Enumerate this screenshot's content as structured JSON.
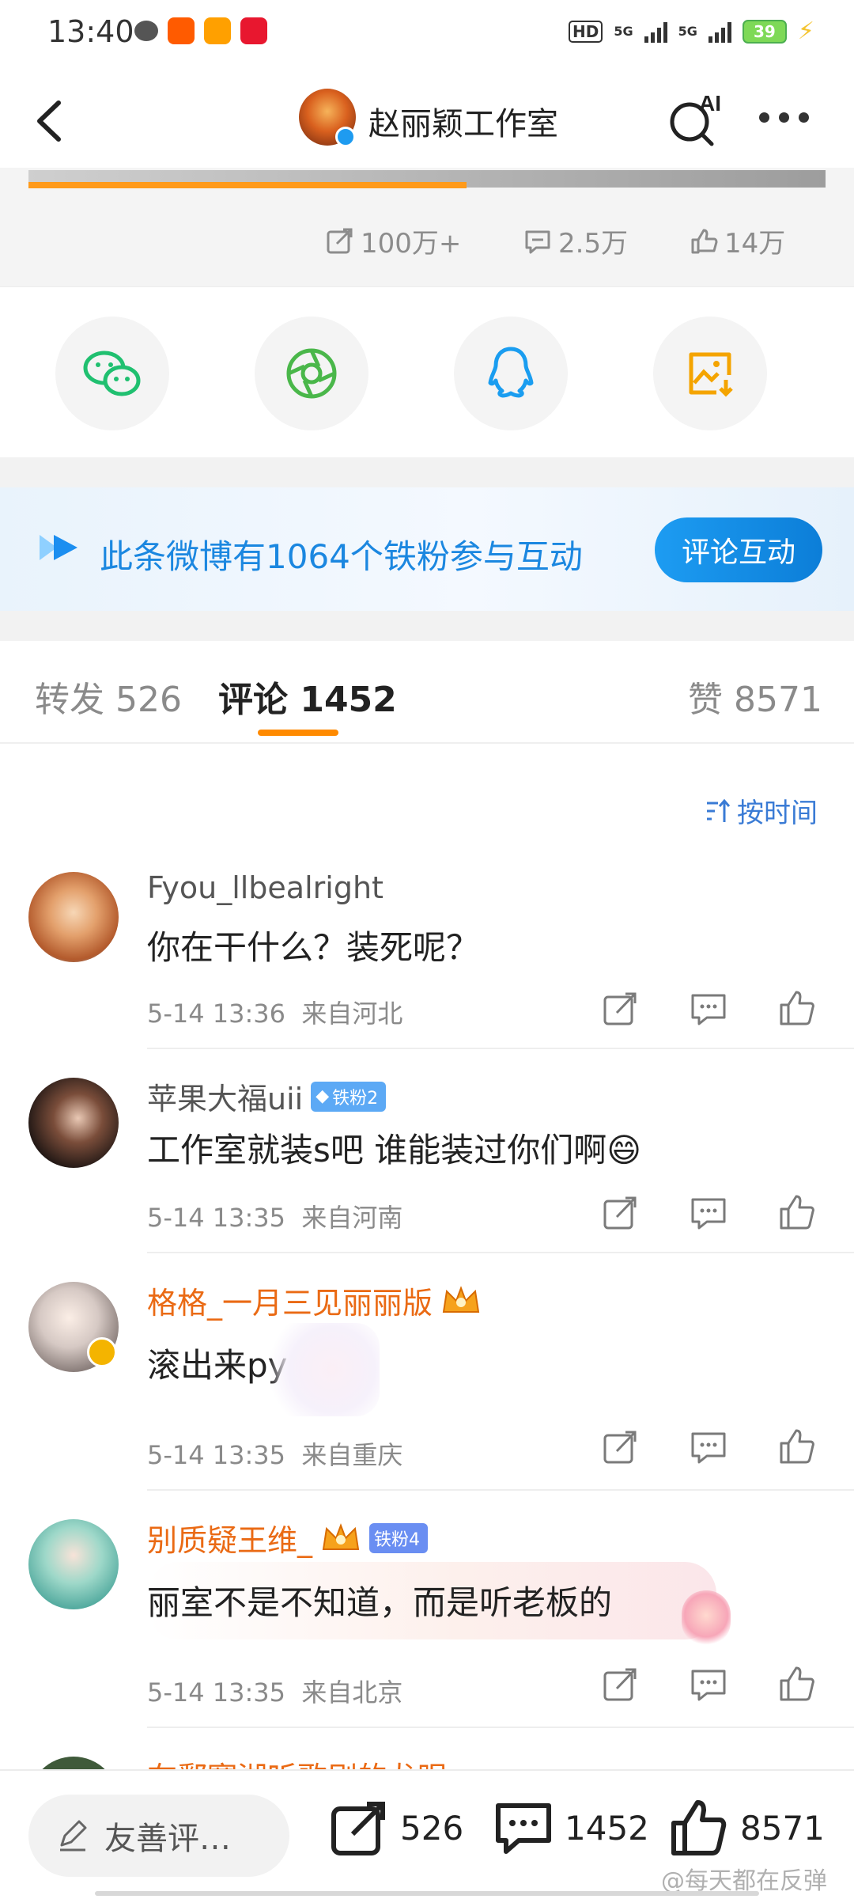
{
  "status": {
    "time": "13:40",
    "network1": "5G",
    "network2": "5G",
    "hd": "HD",
    "battery": "39"
  },
  "header": {
    "title": "赵丽颖工作室",
    "ai_label": "AI"
  },
  "video": {
    "progress": 0.55
  },
  "stats": {
    "repost": "100万+",
    "comments": "2.5万",
    "likes": "14万"
  },
  "share": [
    "wechat-icon",
    "moments-icon",
    "qq-icon",
    "save-image-icon"
  ],
  "banner": {
    "text": "此条微博有1064个铁粉参与互动",
    "button": "评论互动",
    "color": "#1b87e0"
  },
  "tabs": [
    {
      "label": "转发",
      "count": "526"
    },
    {
      "label": "评论",
      "count": "1452"
    },
    {
      "label": "赞",
      "count": "8571"
    }
  ],
  "sort": {
    "label": "按时间"
  },
  "comments": [
    {
      "name": "Fyou_llbealright",
      "text": "你在干什么？装死呢？",
      "time": "5-14 13:36",
      "location": "来自河北",
      "badge": "",
      "emoji": ""
    },
    {
      "name": "苹果大福uii",
      "text": "工作室就装s吧 谁能装过你们啊",
      "time": "5-14 13:35",
      "location": "来自河南",
      "badge": "铁粉2",
      "emoji": "😄"
    },
    {
      "name": "格格_一月三见丽丽版",
      "text": "滚出来py",
      "time": "5-14 13:35",
      "location": "来自重庆",
      "badge": "",
      "emoji": ""
    },
    {
      "name": "别质疑王维_",
      "text": "丽室不是不知道，而是听老板的",
      "time": "5-14 13:35",
      "location": "来自北京",
      "badge": "铁粉4",
      "emoji": ""
    },
    {
      "name": "在鄱赛湖听歌剧的龙眼"
    }
  ],
  "bottom": {
    "input_placeholder": "友善评…",
    "repost": "526",
    "comment": "1452",
    "like": "8571"
  },
  "watermark": "@每天都在反弹",
  "colors": {
    "accent": "#ff8a00",
    "link": "#3a7bd5",
    "vip_name": "#ea6a14"
  }
}
